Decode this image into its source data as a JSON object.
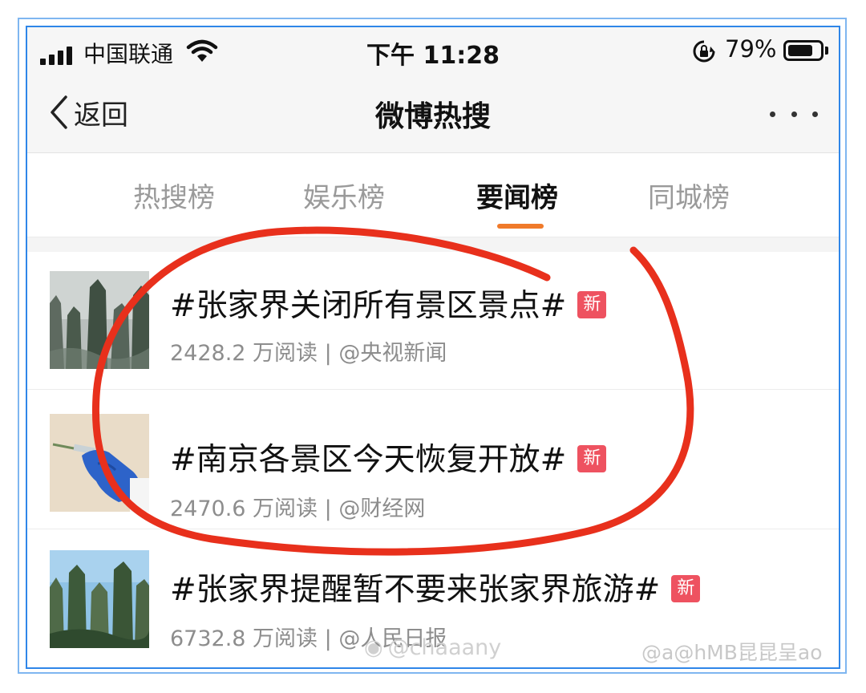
{
  "status_bar": {
    "carrier": "中国联通",
    "time": "下午 11:28",
    "battery_percent": "79%",
    "battery_level": 0.79,
    "icons": [
      "signal-icon",
      "wifi-icon",
      "rotation-lock-icon",
      "battery-icon"
    ]
  },
  "nav": {
    "back_label": "返回",
    "title": "微博热搜",
    "icons": [
      "chevron-left-icon",
      "more-icon"
    ]
  },
  "tabs": [
    {
      "label": "热搜榜",
      "active": false
    },
    {
      "label": "娱乐榜",
      "active": false
    },
    {
      "label": "要闻榜",
      "active": true
    },
    {
      "label": "同城榜",
      "active": false
    }
  ],
  "items": [
    {
      "headline": "#张家界关闭所有景区景点#",
      "badge": "新",
      "meta": "2428.2 万阅读 | @央视新闻"
    },
    {
      "headline": "#南京各景区今天恢复开放#",
      "badge": "新",
      "meta": "2470.6 万阅读 | @财经网"
    },
    {
      "headline": "#张家界提醒暂不要来张家界旅游#",
      "badge": "新",
      "meta": "6732.8 万阅读 | @人民日报"
    }
  ],
  "colors": {
    "accent": "#f07a2a",
    "badge": "#ee5260",
    "annotation": "#e8301c",
    "frame": "#2f86e8"
  },
  "watermarks": [
    {
      "text": "@chaaany"
    },
    {
      "text": "@a@hMB昆昆呈ao"
    }
  ]
}
